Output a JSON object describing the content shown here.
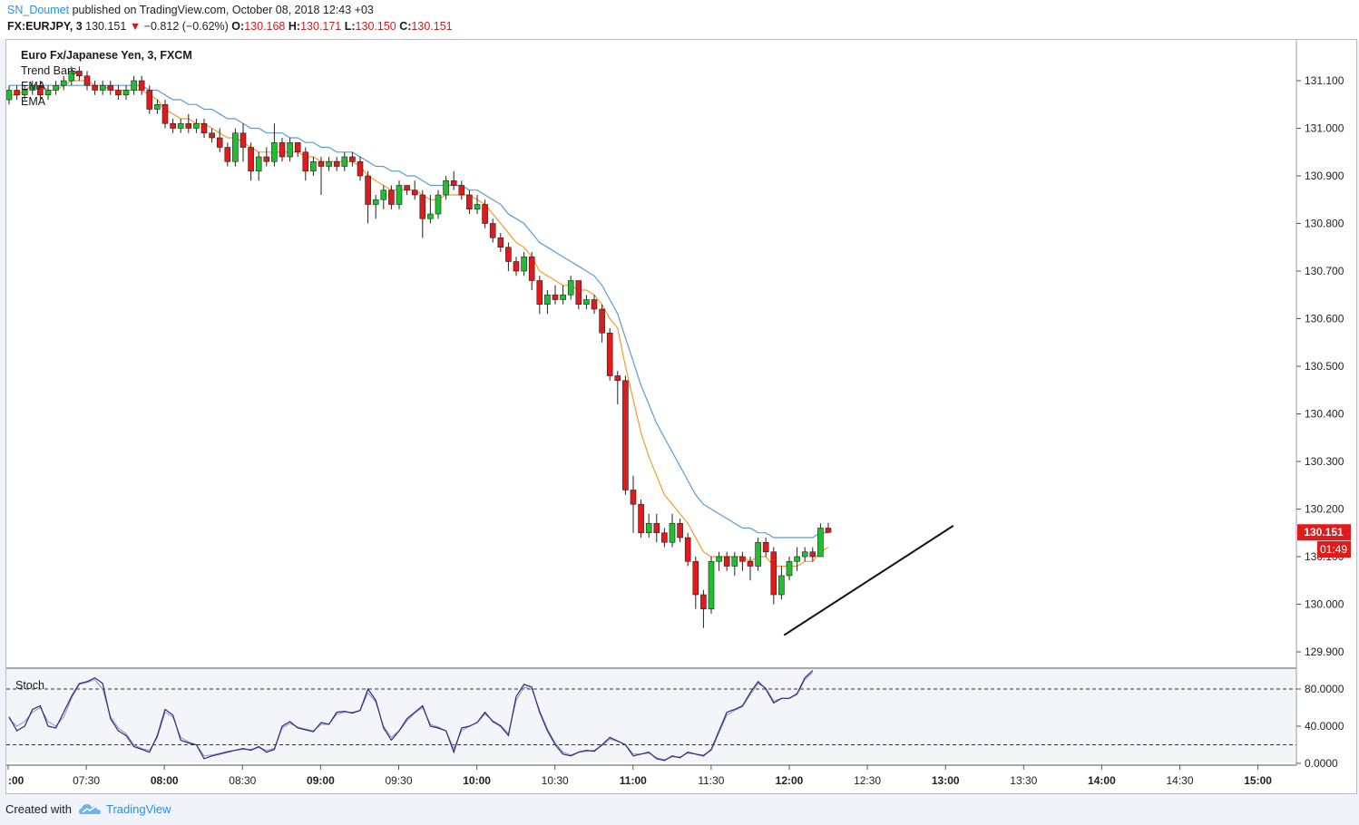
{
  "header": {
    "publisher": "SN_Doumet",
    "published_text": "published on TradingView.com, October 08, 2018 12:43 +03",
    "symbol": "FX:EURJPY, 3",
    "last_price": "130.151",
    "change_arrow": "▼",
    "change": "−0.812 (−0.62%)",
    "open_label": "O:",
    "open": "130.168",
    "high_label": "H:",
    "high": "130.171",
    "low_label": "L:",
    "low": "130.150",
    "close_label": "C:",
    "close": "130.151"
  },
  "legend": {
    "title": "Euro Fx/Japanese Yen, 3, FXCM",
    "study1": "Trend Bars",
    "study2": "EMA",
    "study3": "EMA",
    "stoch": "Stoch"
  },
  "price_badge": "130.151",
  "countdown_badge": "01:49",
  "footer": {
    "created_with": "Created with",
    "brand": "TradingView"
  },
  "colors": {
    "up": "#1fbf30",
    "down": "#e01b1b",
    "ema_fast": "#f39c2c",
    "ema_slow": "#5b9bd5",
    "stoch_line": "#2a2a7a",
    "accent": "#2a8ee8",
    "badge": "#e01b1b"
  },
  "chart_data": {
    "type": "candlestick",
    "symbol": "EURJPY",
    "timeframe": "3",
    "y_axis": {
      "ticks": [
        "131.100",
        "131.000",
        "130.900",
        "130.800",
        "130.700",
        "130.600",
        "130.500",
        "130.400",
        "130.300",
        "130.200",
        "130.100",
        "130.000",
        "129.900"
      ],
      "min": 129.87,
      "max": 131.18
    },
    "x_axis": {
      "ticks": [
        ":00",
        "07:30",
        "08:00",
        "08:30",
        "09:00",
        "09:30",
        "10:00",
        "10:30",
        "11:00",
        "11:30",
        "12:00",
        "12:30",
        "13:00",
        "13:30",
        "14:00",
        "14:30",
        "15:00"
      ],
      "bold_ticks": [
        ":00",
        "08:00",
        "09:00",
        "10:00",
        "11:00",
        "12:00",
        "13:00",
        "14:00",
        "15:00"
      ]
    },
    "stoch_axis": {
      "ticks": [
        "80.0000",
        "40.0000",
        "0.0000"
      ],
      "upper_band": 80,
      "lower_band": 20,
      "min": -5,
      "max": 105
    },
    "candles": [
      [
        131.06,
        131.08,
        131.05,
        131.09
      ],
      [
        131.08,
        131.07,
        131.06,
        131.09
      ],
      [
        131.07,
        131.08,
        131.06,
        131.09
      ],
      [
        131.08,
        131.09,
        131.07,
        131.1
      ],
      [
        131.09,
        131.07,
        131.06,
        131.1
      ],
      [
        131.07,
        131.08,
        131.06,
        131.09
      ],
      [
        131.08,
        131.09,
        131.07,
        131.1
      ],
      [
        131.09,
        131.1,
        131.08,
        131.11
      ],
      [
        131.1,
        131.12,
        131.09,
        131.13
      ],
      [
        131.12,
        131.11,
        131.1,
        131.13
      ],
      [
        131.11,
        131.09,
        131.08,
        131.12
      ],
      [
        131.09,
        131.08,
        131.07,
        131.1
      ],
      [
        131.08,
        131.09,
        131.07,
        131.1
      ],
      [
        131.09,
        131.08,
        131.07,
        131.1
      ],
      [
        131.08,
        131.07,
        131.06,
        131.09
      ],
      [
        131.07,
        131.08,
        131.06,
        131.09
      ],
      [
        131.08,
        131.1,
        131.07,
        131.11
      ],
      [
        131.1,
        131.08,
        131.07,
        131.11
      ],
      [
        131.08,
        131.04,
        131.03,
        131.09
      ],
      [
        131.04,
        131.05,
        131.03,
        131.06
      ],
      [
        131.05,
        131.01,
        131.0,
        131.06
      ],
      [
        131.01,
        131.0,
        130.99,
        131.02
      ],
      [
        131.0,
        131.01,
        130.99,
        131.02
      ],
      [
        131.01,
        131.0,
        130.99,
        131.03
      ],
      [
        131.0,
        131.01,
        130.99,
        131.02
      ],
      [
        131.01,
        130.99,
        130.98,
        131.02
      ],
      [
        130.99,
        130.98,
        130.97,
        131.0
      ],
      [
        130.98,
        130.96,
        130.95,
        131.0
      ],
      [
        130.96,
        130.93,
        130.92,
        130.97
      ],
      [
        130.93,
        130.99,
        130.92,
        131.0
      ],
      [
        130.99,
        130.96,
        130.93,
        131.01
      ],
      [
        130.96,
        130.91,
        130.89,
        130.97
      ],
      [
        130.91,
        130.94,
        130.89,
        130.95
      ],
      [
        130.94,
        130.93,
        130.92,
        130.96
      ],
      [
        130.93,
        130.97,
        130.92,
        131.01
      ],
      [
        130.97,
        130.94,
        130.93,
        130.98
      ],
      [
        130.94,
        130.97,
        130.93,
        130.98
      ],
      [
        130.97,
        130.95,
        130.94,
        130.97
      ],
      [
        130.95,
        130.91,
        130.89,
        130.96
      ],
      [
        130.91,
        130.93,
        130.9,
        130.94
      ],
      [
        130.93,
        130.92,
        130.86,
        130.94
      ],
      [
        130.92,
        130.93,
        130.91,
        130.94
      ],
      [
        130.93,
        130.92,
        130.91,
        130.94
      ],
      [
        130.92,
        130.94,
        130.91,
        130.95
      ],
      [
        130.94,
        130.93,
        130.92,
        130.95
      ],
      [
        130.93,
        130.9,
        130.89,
        130.94
      ],
      [
        130.9,
        130.84,
        130.8,
        130.91
      ],
      [
        130.84,
        130.85,
        130.81,
        130.86
      ],
      [
        130.85,
        130.87,
        130.83,
        130.88
      ],
      [
        130.87,
        130.84,
        130.83,
        130.88
      ],
      [
        130.84,
        130.88,
        130.83,
        130.89
      ],
      [
        130.88,
        130.87,
        130.86,
        130.88
      ],
      [
        130.87,
        130.86,
        130.85,
        130.89
      ],
      [
        130.86,
        130.81,
        130.77,
        130.87
      ],
      [
        130.81,
        130.82,
        130.8,
        130.86
      ],
      [
        130.82,
        130.86,
        130.81,
        130.87
      ],
      [
        130.86,
        130.89,
        130.85,
        130.9
      ],
      [
        130.89,
        130.88,
        130.87,
        130.91
      ],
      [
        130.88,
        130.86,
        130.85,
        130.89
      ],
      [
        130.86,
        130.83,
        130.82,
        130.87
      ],
      [
        130.83,
        130.84,
        130.82,
        130.86
      ],
      [
        130.84,
        130.8,
        130.79,
        130.85
      ],
      [
        130.8,
        130.77,
        130.76,
        130.81
      ],
      [
        130.77,
        130.75,
        130.74,
        130.78
      ],
      [
        130.75,
        130.72,
        130.7,
        130.76
      ],
      [
        130.72,
        130.7,
        130.69,
        130.73
      ],
      [
        130.7,
        130.73,
        130.69,
        130.74
      ],
      [
        130.73,
        130.68,
        130.66,
        130.74
      ],
      [
        130.68,
        130.63,
        130.61,
        130.69
      ],
      [
        130.63,
        130.65,
        130.61,
        130.66
      ],
      [
        130.65,
        130.64,
        130.63,
        130.67
      ],
      [
        130.64,
        130.65,
        130.63,
        130.67
      ],
      [
        130.65,
        130.68,
        130.64,
        130.69
      ],
      [
        130.68,
        130.63,
        130.62,
        130.68
      ],
      [
        130.63,
        130.64,
        130.62,
        130.65
      ],
      [
        130.64,
        130.62,
        130.61,
        130.65
      ],
      [
        130.62,
        130.57,
        130.55,
        130.63
      ],
      [
        130.57,
        130.48,
        130.47,
        130.58
      ],
      [
        130.48,
        130.47,
        130.42,
        130.49
      ],
      [
        130.47,
        130.24,
        130.23,
        130.48
      ],
      [
        130.24,
        130.21,
        130.15,
        130.27
      ],
      [
        130.21,
        130.15,
        130.14,
        130.22
      ],
      [
        130.15,
        130.17,
        130.14,
        130.19
      ],
      [
        130.17,
        130.15,
        130.13,
        130.19
      ],
      [
        130.15,
        130.13,
        130.12,
        130.16
      ],
      [
        130.13,
        130.17,
        130.12,
        130.19
      ],
      [
        130.17,
        130.14,
        130.13,
        130.18
      ],
      [
        130.14,
        130.09,
        130.08,
        130.15
      ],
      [
        130.09,
        130.02,
        129.99,
        130.1
      ],
      [
        130.02,
        129.99,
        129.95,
        130.03
      ],
      [
        129.99,
        130.09,
        129.98,
        130.1
      ],
      [
        130.09,
        130.1,
        130.07,
        130.11
      ],
      [
        130.1,
        130.08,
        130.07,
        130.11
      ],
      [
        130.08,
        130.1,
        130.06,
        130.11
      ],
      [
        130.1,
        130.09,
        130.07,
        130.11
      ],
      [
        130.09,
        130.08,
        130.05,
        130.1
      ],
      [
        130.08,
        130.13,
        130.07,
        130.14
      ],
      [
        130.13,
        130.11,
        130.1,
        130.14
      ],
      [
        130.11,
        130.02,
        130.0,
        130.12
      ],
      [
        130.02,
        130.06,
        130.01,
        130.08
      ],
      [
        130.06,
        130.09,
        130.05,
        130.1
      ],
      [
        130.09,
        130.1,
        130.07,
        130.12
      ],
      [
        130.1,
        130.11,
        130.09,
        130.12
      ],
      [
        130.11,
        130.1,
        130.09,
        130.12
      ],
      [
        130.1,
        130.16,
        130.1,
        130.17
      ],
      [
        130.16,
        130.151,
        130.15,
        130.171
      ]
    ],
    "ema_fast": [
      131.07,
      131.07,
      131.08,
      131.09,
      131.09,
      131.08,
      131.08,
      131.09,
      131.1,
      131.1,
      131.1,
      131.09,
      131.09,
      131.08,
      131.08,
      131.08,
      131.08,
      131.08,
      131.07,
      131.06,
      131.04,
      131.03,
      131.02,
      131.02,
      131.01,
      131.01,
      131.0,
      130.99,
      130.98,
      130.98,
      130.97,
      130.96,
      130.95,
      130.95,
      130.95,
      130.95,
      130.95,
      130.95,
      130.94,
      130.94,
      130.93,
      130.93,
      130.93,
      130.93,
      130.93,
      130.92,
      130.9,
      130.89,
      130.88,
      130.87,
      130.87,
      130.87,
      130.87,
      130.86,
      130.85,
      130.85,
      130.86,
      130.86,
      130.86,
      130.86,
      130.85,
      130.84,
      130.82,
      130.8,
      130.78,
      130.76,
      130.75,
      130.73,
      130.7,
      130.69,
      130.68,
      130.67,
      130.67,
      130.66,
      130.66,
      130.65,
      130.63,
      130.6,
      130.58,
      130.5,
      130.43,
      130.36,
      130.31,
      130.27,
      130.23,
      130.21,
      130.19,
      130.17,
      130.14,
      130.11,
      130.1,
      130.1,
      130.1,
      130.1,
      130.1,
      130.09,
      130.1,
      130.1,
      130.08,
      130.08,
      130.08,
      130.08,
      130.09,
      130.09,
      130.11,
      130.12
    ],
    "ema_slow": [
      131.09,
      131.09,
      131.09,
      131.09,
      131.09,
      131.09,
      131.09,
      131.09,
      131.09,
      131.09,
      131.09,
      131.09,
      131.09,
      131.09,
      131.09,
      131.09,
      131.09,
      131.09,
      131.08,
      131.08,
      131.07,
      131.06,
      131.06,
      131.05,
      131.05,
      131.04,
      131.04,
      131.03,
      131.02,
      131.02,
      131.01,
      131.0,
      131.0,
      130.99,
      130.99,
      130.99,
      130.98,
      130.98,
      130.97,
      130.97,
      130.96,
      130.96,
      130.95,
      130.95,
      130.95,
      130.94,
      130.93,
      130.92,
      130.92,
      130.91,
      130.91,
      130.9,
      130.9,
      130.89,
      130.88,
      130.88,
      130.88,
      130.88,
      130.88,
      130.87,
      130.87,
      130.86,
      130.85,
      130.84,
      130.82,
      130.81,
      130.8,
      130.78,
      130.76,
      130.75,
      130.74,
      130.73,
      130.72,
      130.71,
      130.7,
      130.69,
      130.67,
      130.64,
      130.61,
      130.56,
      130.51,
      130.46,
      130.42,
      130.38,
      130.35,
      130.32,
      130.29,
      130.26,
      130.23,
      130.21,
      130.2,
      130.19,
      130.18,
      130.17,
      130.16,
      130.16,
      130.15,
      130.15,
      130.14,
      130.14,
      130.14,
      130.14,
      130.14,
      130.14,
      130.15,
      130.15
    ],
    "stoch_k": [
      50,
      35,
      40,
      58,
      62,
      40,
      38,
      55,
      72,
      86,
      88,
      92,
      86,
      48,
      35,
      30,
      18,
      15,
      12,
      30,
      58,
      52,
      25,
      22,
      20,
      5,
      8,
      10,
      12,
      14,
      16,
      14,
      18,
      12,
      15,
      40,
      45,
      38,
      36,
      34,
      44,
      42,
      55,
      56,
      54,
      57,
      80,
      68,
      38,
      25,
      35,
      48,
      55,
      62,
      40,
      38,
      35,
      12,
      38,
      40,
      44,
      55,
      45,
      40,
      30,
      72,
      85,
      82,
      55,
      35,
      20,
      10,
      8,
      12,
      14,
      13,
      20,
      28,
      24,
      20,
      8,
      10,
      12,
      5,
      3,
      8,
      6,
      12,
      10,
      8,
      15,
      35,
      55,
      58,
      62,
      76,
      88,
      80,
      65,
      70,
      70,
      75,
      92,
      100
    ],
    "stoch_d": [
      48,
      40,
      45,
      55,
      60,
      45,
      40,
      50,
      70,
      85,
      87,
      90,
      80,
      50,
      38,
      32,
      20,
      16,
      14,
      28,
      55,
      50,
      28,
      23,
      20,
      8,
      9,
      11,
      13,
      14,
      15,
      15,
      17,
      14,
      16,
      38,
      43,
      39,
      37,
      35,
      42,
      42,
      53,
      55,
      55,
      57,
      76,
      66,
      40,
      28,
      35,
      46,
      54,
      60,
      42,
      39,
      35,
      16,
      35,
      40,
      44,
      53,
      46,
      41,
      32,
      68,
      82,
      80,
      57,
      37,
      22,
      12,
      9,
      12,
      13,
      14,
      19,
      26,
      24,
      20,
      10,
      10,
      11,
      6,
      4,
      7,
      7,
      11,
      10,
      9,
      14,
      33,
      52,
      57,
      61,
      74,
      86,
      81,
      67,
      70,
      70,
      74,
      90,
      98
    ],
    "trendline": {
      "from": {
        "x": "11:58",
        "y": 129.935
      },
      "to": {
        "x": "13:03",
        "y": 130.165
      }
    }
  }
}
